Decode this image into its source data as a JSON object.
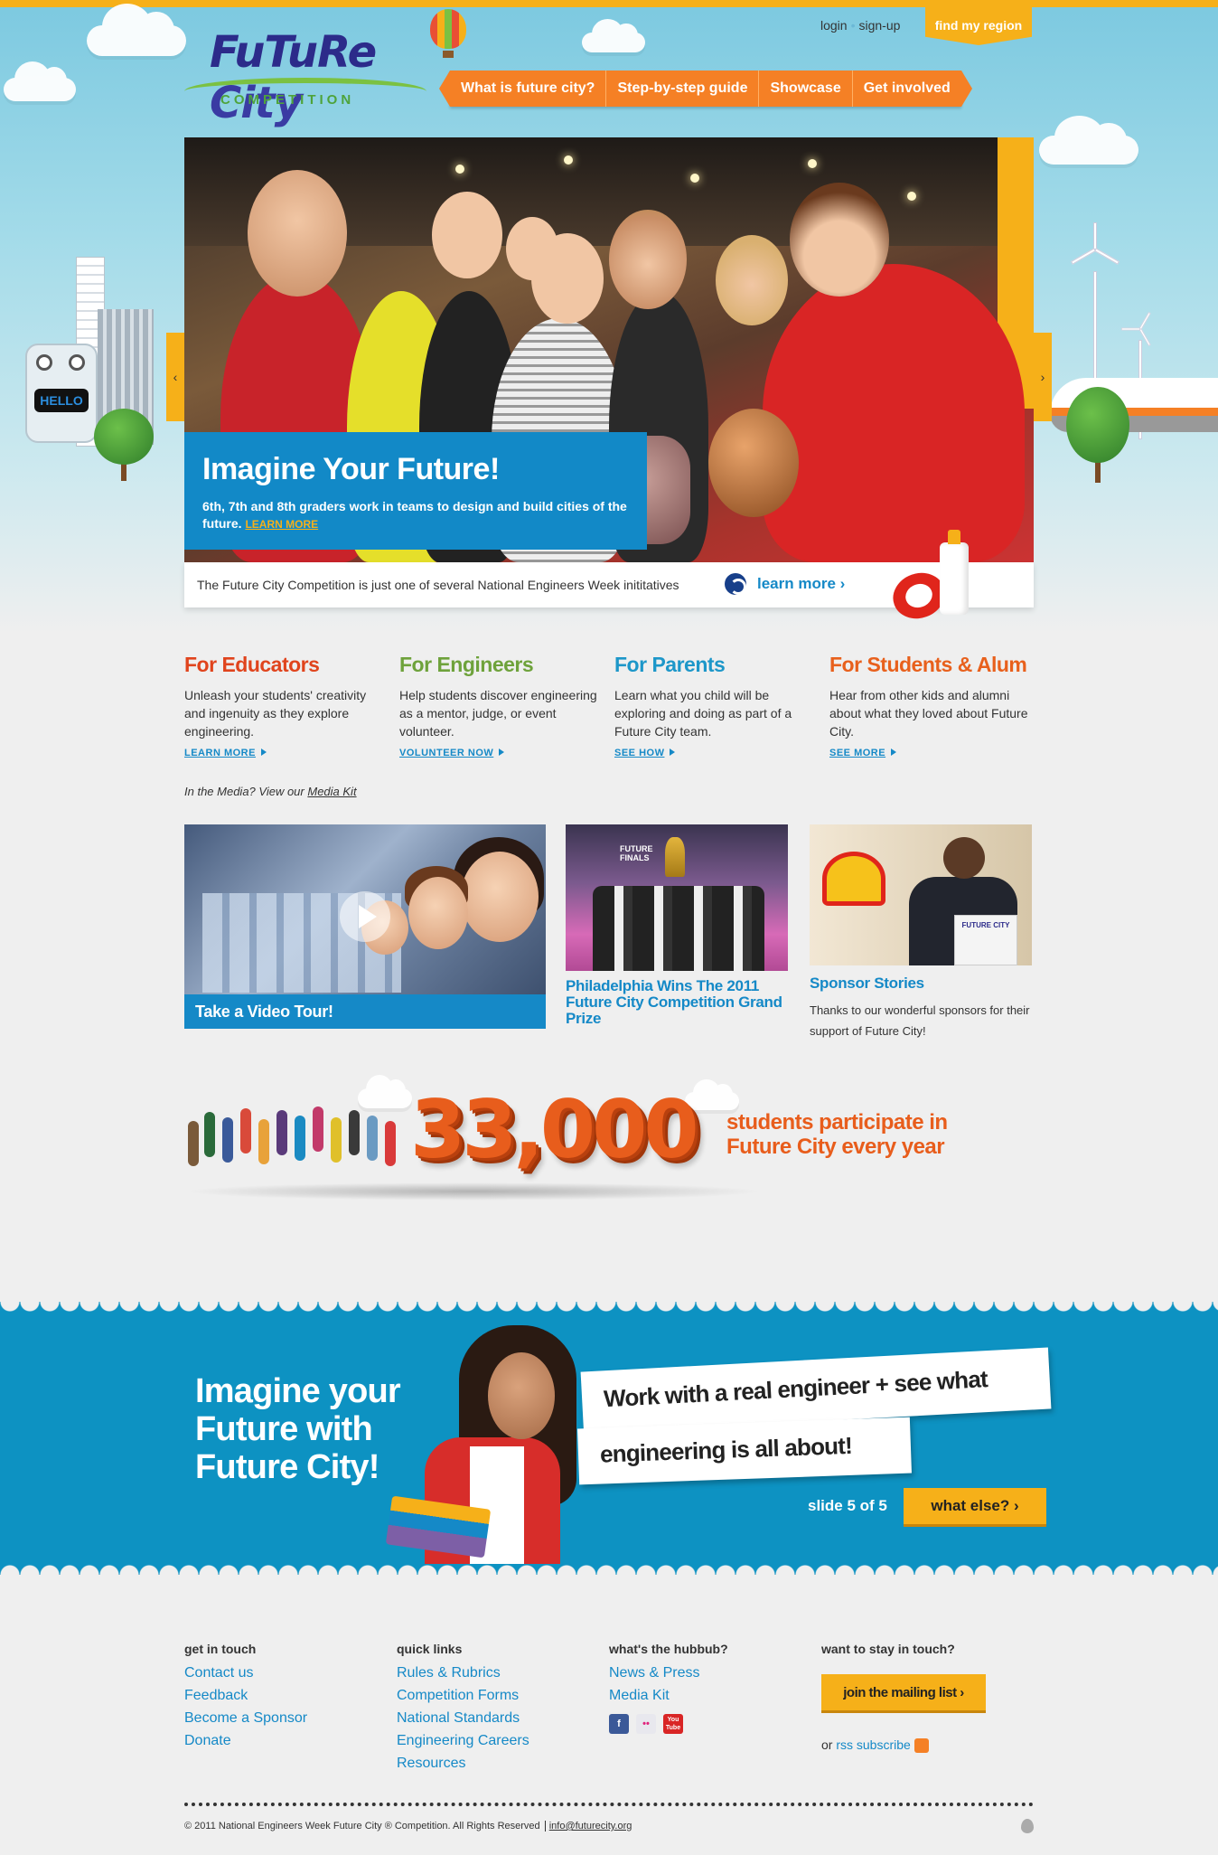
{
  "colors": {
    "accent_orange": "#f58025",
    "accent_yellow": "#f6b019",
    "brand_blue": "#1589c7",
    "band_blue": "#0d92c2",
    "educators": "#e0441d",
    "engineers": "#6ea23b",
    "parents": "#1d97c9",
    "students": "#e8601c"
  },
  "logo": {
    "title_part1": "FuTuRe",
    "title_part2": "City",
    "subtitle": "COMPETITION"
  },
  "toplinks": {
    "login": "login",
    "signup": "sign-up",
    "find_region": "find my region"
  },
  "nav": [
    {
      "label": "What is future city?"
    },
    {
      "label": "Step-by-step guide"
    },
    {
      "label": "Showcase"
    },
    {
      "label": "Get involved"
    }
  ],
  "hero": {
    "robot_screen": "HELLO",
    "title": "Imagine Your Future!",
    "text": "6th, 7th and 8th graders work in teams to design and build cities of the future.",
    "link": "LEARN MORE",
    "prev": "‹",
    "next": "›"
  },
  "strip": {
    "text": "The Future City Competition is just one of several National Engineers Week inititatives",
    "link": "learn more ›"
  },
  "audience": [
    {
      "title": "For Educators",
      "text": "Unleash your students' creativity and ingenuity as they explore engineering.",
      "link": "LEARN MORE",
      "color_key": "educators"
    },
    {
      "title": "For Engineers",
      "text": "Help students discover engineering as a mentor, judge, or event volunteer.",
      "link": "VOLUNTEER NOW",
      "color_key": "engineers"
    },
    {
      "title": "For Parents",
      "text": "Learn what you child will be exploring and doing as part of a Future City team.",
      "link": "SEE HOW",
      "color_key": "parents"
    },
    {
      "title": "For Students & Alum",
      "text": "Hear from other kids and alumni about what they loved about Future City.",
      "link": "SEE MORE",
      "color_key": "students"
    }
  ],
  "media": {
    "prefix": "In the Media? View our",
    "link": "Media Kit"
  },
  "tiles": {
    "video_label": "Take a Video Tour!",
    "phil_banner": "FUTURE FINALS",
    "phil_title": "Philadelphia Wins The 2011 Future City Competition Grand Prize",
    "sponsor_podium": "FUTURE CITY",
    "sponsor_title": "Sponsor Stories",
    "sponsor_text": "Thanks to our wonderful sponsors for their support of Future City!"
  },
  "stat": {
    "number": "33,000",
    "text": "students participate in Future City every year"
  },
  "band": {
    "title": "Imagine your Future with Future City!",
    "card1": "Work with a real engineer + see what",
    "card2": "engineering is all about!",
    "slide": "slide 5 of 5",
    "button": "what else?  ›"
  },
  "footer": {
    "get_in_touch": {
      "heading": "get in touch",
      "links": [
        "Contact us",
        "Feedback",
        "Become a Sponsor",
        "Donate"
      ]
    },
    "quick_links": {
      "heading": "quick links",
      "links": [
        "Rules & Rubrics",
        "Competition Forms",
        "National Standards",
        "Engineering Careers",
        "Resources"
      ]
    },
    "hubbub": {
      "heading": "what's the hubbub?",
      "links": [
        "News & Press",
        "Media Kit"
      ],
      "social": {
        "facebook": "f",
        "flickr": "••",
        "youtube": "You Tube"
      }
    },
    "stay": {
      "heading": "want to stay in touch?",
      "button": "join the mailing list  ›",
      "or": "or",
      "rss": "rss subscribe"
    },
    "copyright": "© 2011 National Engineers Week Future City ® Competition. All Rights Reserved",
    "email": "info@futurecity.org"
  }
}
